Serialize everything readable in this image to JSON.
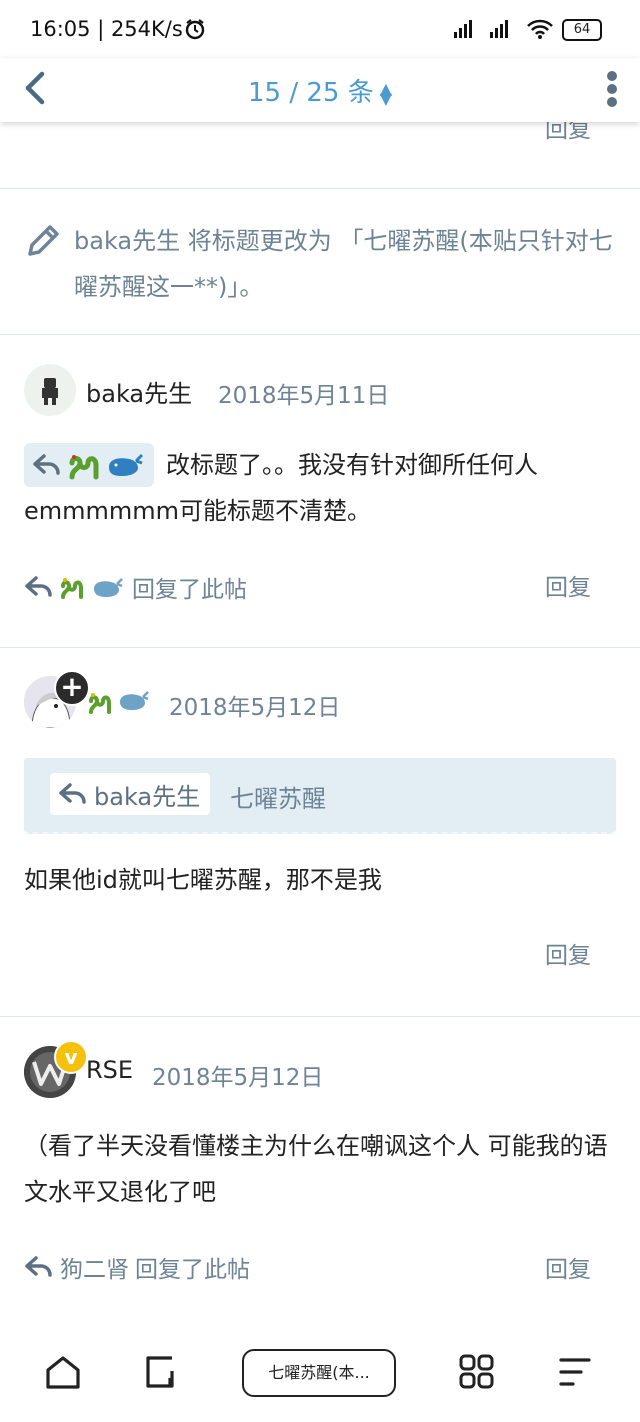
{
  "status_bar": {
    "time": "16:05 | 254K/s",
    "battery": "64"
  },
  "header": {
    "counter": "15 / 25 条"
  },
  "top_partial": {
    "reply_label": "回复"
  },
  "title_change": {
    "text": "baka先生 将标题更改为 「七曜苏醒(本贴只针对七曜苏醒这一**)」。"
  },
  "posts": [
    {
      "author": "baka先生",
      "date": "2018年5月11日",
      "body": "改标题了。。我没有针对御所任何人emmmmmm可能标题不清楚。",
      "footer_reply_to": "回复了此帖",
      "reply_label": "回复"
    },
    {
      "author": "",
      "date": "2018年5月12日",
      "quote_author": "baka先生",
      "quote_topic": "七曜苏醒",
      "body": "如果他id就叫七曜苏醒，那不是我",
      "reply_label": "回复"
    },
    {
      "author": "RSE",
      "date": "2018年5月12日",
      "body": "（看了半天没看懂楼主为什么在嘲讽这个人 可能我的语文水平又退化了吧",
      "footer_user": "狗二肾",
      "footer_reply_to": "回复了此帖",
      "reply_label": "回复"
    }
  ],
  "bottom_nav": {
    "chip_label": "七曜苏醒(本..."
  },
  "colors": {
    "accent": "#4a9bd1",
    "muted": "#6e8396",
    "quote_bg": "#e2edf4"
  }
}
